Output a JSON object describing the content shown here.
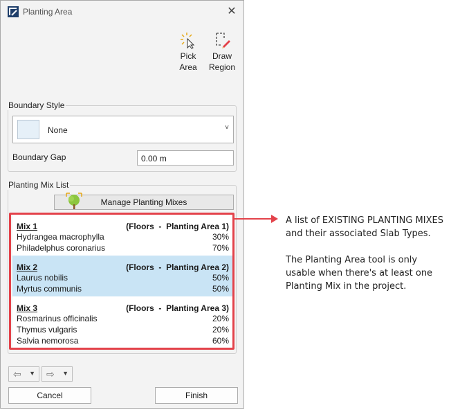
{
  "dialog": {
    "title": "Planting Area",
    "close_glyph": "✕",
    "tools": [
      {
        "icon": "pick-area-icon",
        "label_line1": "Pick",
        "label_line2": "Area"
      },
      {
        "icon": "draw-region-icon",
        "label_line1": "Draw",
        "label_line2": "Region"
      }
    ],
    "boundary_style": {
      "group_label": "Boundary Style",
      "selected_value": "None",
      "chevron": "˅",
      "gap_label": "Boundary Gap",
      "gap_value": "0.00 m"
    },
    "planting_mix": {
      "group_label": "Planting Mix List",
      "manage_button_label": "Manage Planting Mixes",
      "mixes": [
        {
          "name": "Mix 1",
          "slab": "(Floors  -  Planting Area 1)",
          "selected": false,
          "plants": [
            {
              "name": "Hydrangea macrophylla",
              "pct": "30%"
            },
            {
              "name": "Philadelphus coronarius",
              "pct": "70%"
            }
          ]
        },
        {
          "name": "Mix 2",
          "slab": "(Floors  -  Planting Area 2)",
          "selected": true,
          "plants": [
            {
              "name": "Laurus nobilis",
              "pct": "50%"
            },
            {
              "name": "Myrtus communis",
              "pct": "50%"
            }
          ]
        },
        {
          "name": "Mix 3",
          "slab": "(Floors  -  Planting Area 3)",
          "selected": false,
          "plants": [
            {
              "name": "Rosmarinus officinalis",
              "pct": "20%"
            },
            {
              "name": "Thymus vulgaris",
              "pct": "20%"
            },
            {
              "name": "Salvia nemorosa",
              "pct": "60%"
            }
          ]
        }
      ]
    },
    "nav": {
      "undo_icon": "undo-icon",
      "redo_icon": "redo-icon"
    },
    "buttons": {
      "cancel": "Cancel",
      "finish": "Finish"
    }
  },
  "annotation": {
    "line1": "A list of EXISTING PLANTING MIXES",
    "line2": "and their associated Slab Types.",
    "line3": "The Planting Area tool is only",
    "line4": "usable when there's at least one",
    "line5": "Planting Mix in the project."
  },
  "colors": {
    "highlight": "#e3424a",
    "selected_row": "#c9e4f5",
    "accent": "#1f3e6a"
  }
}
